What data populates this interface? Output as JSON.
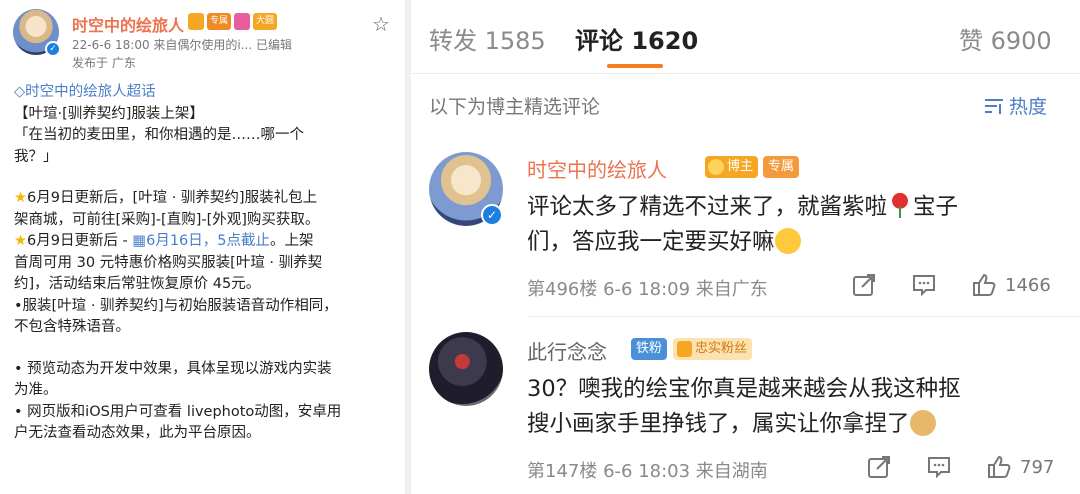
{
  "post": {
    "author": "时空中的绘旅人",
    "badges": [
      "crown-badge",
      "vip-badge",
      "heart-badge",
      "big-badge"
    ],
    "vip_label": "专属",
    "big_label": "大圆",
    "meta": "22-6-6 18:00  来自偶尔使用的i...  已编辑",
    "location": "发布于 广东",
    "topic": "时空中的绘旅人超话",
    "lines": [
      "【叶瑄·[驯养契约]服装上架】",
      "「在当初的麦田里，和你相遇的是……哪一个",
      "我？」",
      "6月9日更新后，[叶瑄 · 驯养契约]服装礼包上",
      "架商城，可前往[采购]-[直购]-[外观]购买获取。",
      "6月9日更新后 - ",
      "6月16日，5点截止",
      "。上架",
      "首周可用 30 元特惠价格购买服装[叶瑄 · 驯养契",
      "约]，活动结束后常驻恢复原价 45元。",
      "•服装[叶瑄 · 驯养契约]与初始服装语音动作相同，",
      "不包含特殊语音。",
      "• 预览动态为开发中效果，具体呈现以游戏内实装",
      "为准。",
      "• 网页版和iOS用户可查看 livephoto动图，安卓用",
      "户无法查看动态效果，此为平台原因。"
    ]
  },
  "tabs": {
    "repost": "转发 1585",
    "comment": "评论 1620",
    "like": "赞 6900"
  },
  "filter": {
    "label": "以下为博主精选评论",
    "sort": "热度"
  },
  "comments": [
    {
      "name": "时空中的绘旅人",
      "tags": [
        "博主",
        "专属"
      ],
      "text_lines": [
        "评论太多了精选不过来了，就酱紫啦",
        "宝子",
        "们，答应我一定要买好嘛"
      ],
      "meta": "第496楼  6-6 18:09  来自广东",
      "likes": "1466"
    },
    {
      "name": "此行念念",
      "tags": [
        "铁粉",
        "忠实粉丝"
      ],
      "text_lines": [
        "30？噢我的绘宝你真是越来越会从我这种抠",
        "搜小画家手里挣钱了，属实让你拿捏了"
      ],
      "meta": "第147楼  6-6 18:03  来自湖南",
      "likes": "797"
    }
  ]
}
